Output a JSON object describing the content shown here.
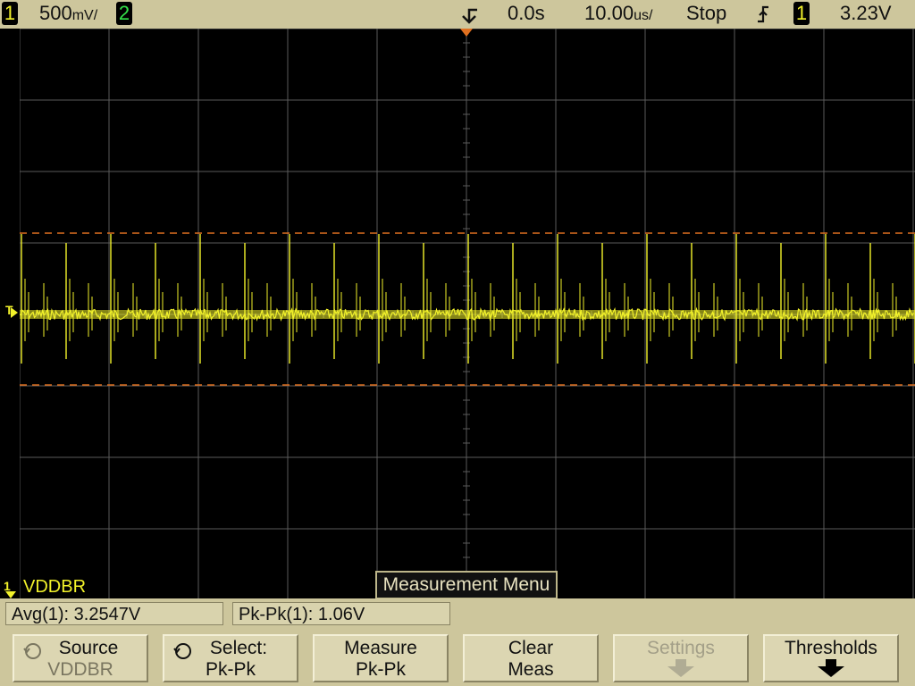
{
  "topbar": {
    "ch1_label": "1",
    "ch1_scale": "500",
    "ch1_unit": "mV/",
    "ch2_label": "2",
    "trigger_position_icon": "trigger-position-arrow",
    "delay": "0.0s",
    "timebase": "10.00",
    "timebase_unit": "us/",
    "run_state": "Stop",
    "trigger_edge_icon": "rising-edge-icon",
    "trigger_source": "1",
    "trigger_level": "3.23V"
  },
  "screen": {
    "channel_name": "VDDBR",
    "ground_marker": "1",
    "trigger_marker": "T",
    "menu_title": "Measurement Menu"
  },
  "measurements": [
    {
      "label": "Avg(1):",
      "value": "3.2547V"
    },
    {
      "label": "Pk-Pk(1):",
      "value": "1.06V"
    }
  ],
  "softkeys": [
    {
      "line1": "Source",
      "line2": "VDDBR",
      "icon": "rotate-knob-icon",
      "state": "dim-value"
    },
    {
      "line1": "Select:",
      "line2": "Pk-Pk",
      "icon": "rotate-knob-icon",
      "state": "normal"
    },
    {
      "line1": "Measure",
      "line2": "Pk-Pk",
      "state": "normal"
    },
    {
      "line1": "Clear",
      "line2": "Meas",
      "state": "normal"
    },
    {
      "line1": "Settings",
      "icon": "down-arrow-icon",
      "state": "disabled"
    },
    {
      "line1": "Thresholds",
      "icon": "down-arrow-icon",
      "state": "normal"
    }
  ],
  "colors": {
    "trace": "#f2f22a",
    "grid": "#5a5a5a",
    "cursor": "#e07020",
    "panel": "#cdc69c"
  }
}
